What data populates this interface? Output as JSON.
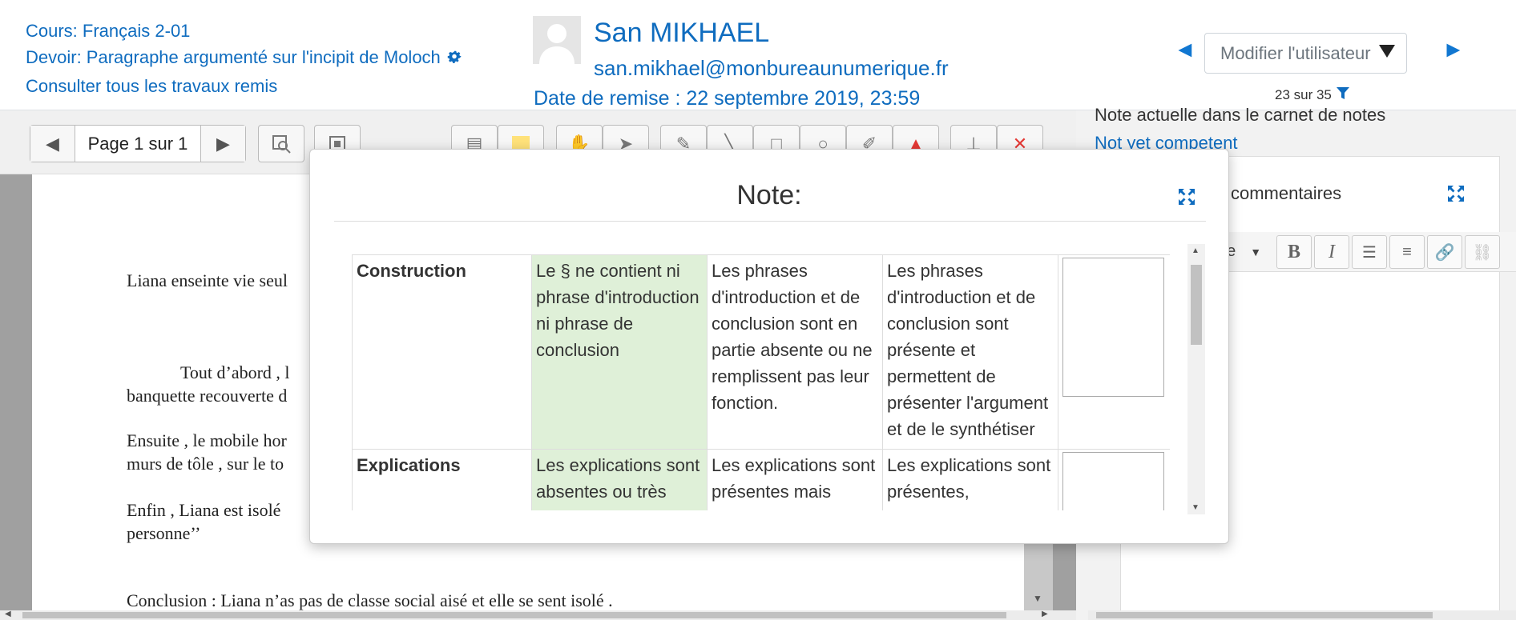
{
  "header": {
    "course_link": "Cours: Français 2-01",
    "assignment_link": "Devoir: Paragraphe argumenté sur l'incipit de Moloch",
    "submissions_link": "Consulter tous les travaux remis",
    "user_name": "San MIKHAEL",
    "user_email": "san.mikhael@monbureaunumerique.fr",
    "due_date": "Date de remise : 22 septembre 2019, 23:59",
    "user_select_label": "Modifier l'utilisateur",
    "position_count": "23 sur 35",
    "nav_prev": "◄",
    "nav_next": "►"
  },
  "toolbar": {
    "page_label": "Page 1 sur 1"
  },
  "document": {
    "lines": [
      "Liana enseinte vie seul",
      "Tout d’abord , l",
      "banquette recouverte d",
      "Ensuite , le mobile hor",
      "murs de tôle , sur le to",
      "Enfin , Liana est isolé",
      "personne’’",
      "Conclusion : Liana n’as pas de classe social aisé et elle se sent isolé ."
    ]
  },
  "right_panel": {
    "grade_label": "Note actuelle dans le carnet de notes",
    "grade_value": "Not yet competent",
    "comments_label": "commentaires",
    "format_label": "ne"
  },
  "modal": {
    "title": "Note:",
    "rubric": [
      {
        "criterion": "Construction",
        "levels": [
          {
            "text": "Le § ne contient ni phrase d'introduction ni phrase de conclusion",
            "selected": true
          },
          {
            "text": "Les phrases d'introduction et de conclusion sont en partie absente ou ne remplissent pas leur fonction.",
            "selected": false
          },
          {
            "text": "Les phrases d'introduction et de conclusion sont présente et permettent de présenter l'argument et de le synthétiser",
            "selected": false
          }
        ]
      },
      {
        "criterion": "Explications",
        "levels": [
          {
            "text": "Les explications sont absentes ou très insuffisantes",
            "selected": true
          },
          {
            "text": "Les explications sont présentes mais insuffisantes et/ou",
            "selected": false
          },
          {
            "text": "Les explications sont présentes, développées et",
            "selected": false
          }
        ]
      }
    ]
  },
  "colors": {
    "link": "#0f6cbf",
    "selected_level": "#dff0d8",
    "delete_red": "#e53935"
  }
}
